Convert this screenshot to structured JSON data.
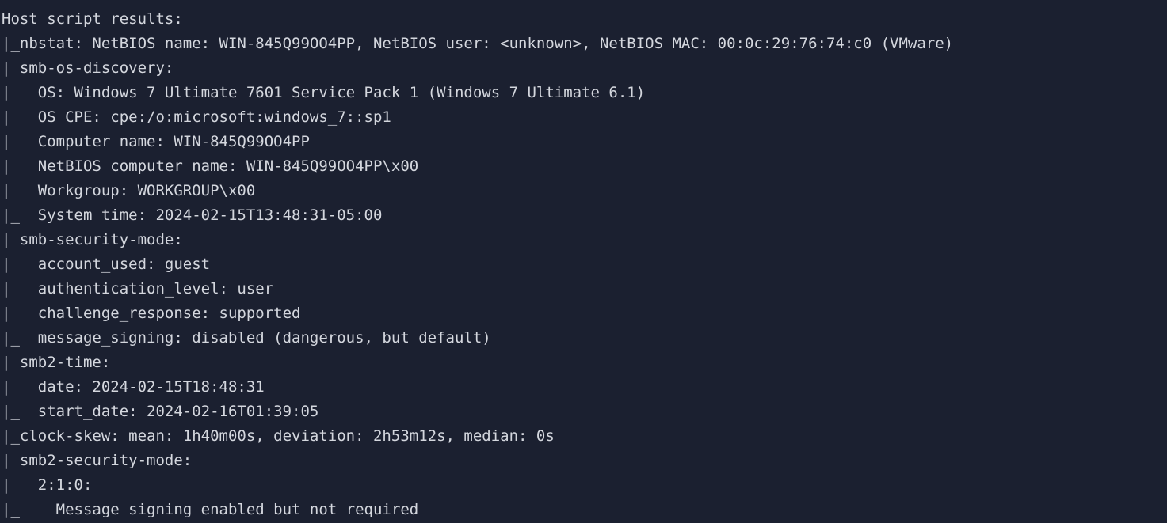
{
  "terminal": {
    "lines": [
      {
        "text": "Host script results:",
        "bar": "none"
      },
      {
        "text": "|_nbstat: NetBIOS name: WIN-845Q99OO4PP, NetBIOS user: <unknown>, NetBIOS MAC: 00:0c:29:76:74:c0 (VMware)",
        "bar": "none"
      },
      {
        "text": "| smb-os-discovery:",
        "bar": "none"
      },
      {
        "text": "|   OS: Windows 7 Ultimate 7601 Service Pack 1 (Windows 7 Ultimate 6.1)",
        "bar": "cyan"
      },
      {
        "text": "|   OS CPE: cpe:/o:microsoft:windows_7::sp1",
        "bar": "cyan"
      },
      {
        "text": "|   Computer name: WIN-845Q99OO4PP",
        "bar": "cyan"
      },
      {
        "text": "|   NetBIOS computer name: WIN-845Q99OO4PP\\x00",
        "bar": "none"
      },
      {
        "text": "|   Workgroup: WORKGROUP\\x00",
        "bar": "none"
      },
      {
        "text": "|_  System time: 2024-02-15T13:48:31-05:00",
        "bar": "none"
      },
      {
        "text": "| smb-security-mode:",
        "bar": "none"
      },
      {
        "text": "|   account_used: guest",
        "bar": "none"
      },
      {
        "text": "|   authentication_level: user",
        "bar": "none"
      },
      {
        "text": "|   challenge_response: supported",
        "bar": "none"
      },
      {
        "text": "|_  message_signing: disabled (dangerous, but default)",
        "bar": "none"
      },
      {
        "text": "| smb2-time:",
        "bar": "none"
      },
      {
        "text": "|   date: 2024-02-15T18:48:31",
        "bar": "none"
      },
      {
        "text": "|_  start_date: 2024-02-16T01:39:05",
        "bar": "none"
      },
      {
        "text": "|_clock-skew: mean: 1h40m00s, deviation: 2h53m12s, median: 0s",
        "bar": "none"
      },
      {
        "text": "| smb2-security-mode:",
        "bar": "none"
      },
      {
        "text": "|   2:1:0:",
        "bar": "none"
      },
      {
        "text": "|_    Message signing enabled but not required",
        "bar": "none"
      }
    ]
  },
  "colors": {
    "background": "#1b2030",
    "foreground": "#d4d7de",
    "cursor_bar": "#35a3b8"
  }
}
